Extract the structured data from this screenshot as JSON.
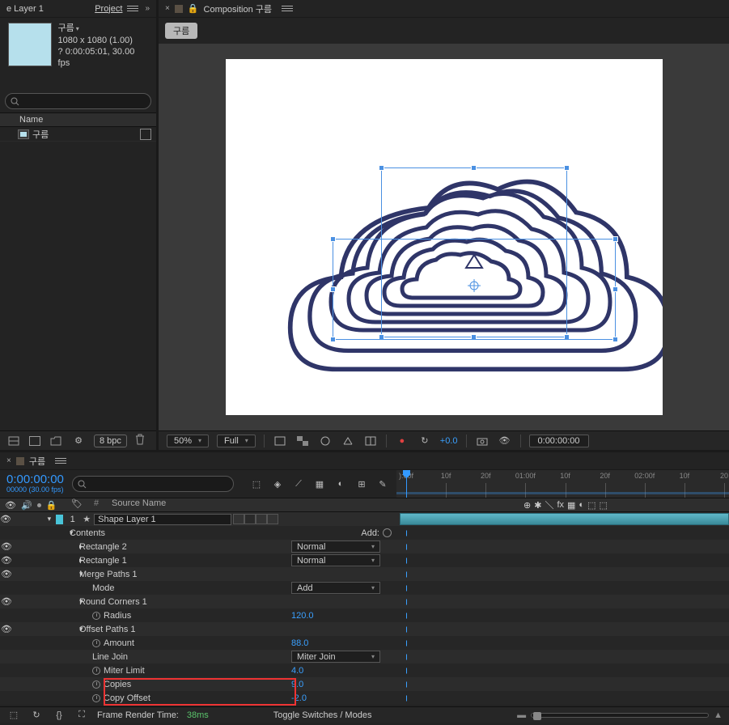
{
  "project": {
    "tab_partial": "e Layer 1",
    "panel_label": "Project",
    "comp_name": "구름",
    "dims": "1080 x 1080 (1.00)",
    "duration": "? 0:00:05:01, 30.00 fps",
    "bpc": "8 bpc",
    "col_name": "Name",
    "row_name": "구름"
  },
  "viewer": {
    "tab_prefix": "Composition",
    "tab_name": "구름",
    "crumb": "구름",
    "zoom": "50%",
    "res": "Full",
    "exposure": "+0.0",
    "timecode": "0:00:00:00"
  },
  "timeline": {
    "tab_name": "구름",
    "current_time": "0:00:00:00",
    "frame_fps": "00000 (30.00 fps)",
    "ruler": [
      "):00f",
      "10f",
      "20f",
      "01:00f",
      "10f",
      "20f",
      "02:00f",
      "10f",
      "20"
    ],
    "col_num": "#",
    "col_source": "Source Name",
    "layer_num": "1",
    "layer_name": "Shape Layer 1",
    "contents": "Contents",
    "add": "Add:",
    "rect2": "Rectangle 2",
    "rect1": "Rectangle 1",
    "normal": "Normal",
    "merge": "Merge Paths 1",
    "mode": "Mode",
    "mode_val": "Add",
    "round": "Round Corners 1",
    "radius": "Radius",
    "radius_val": "120.0",
    "offset": "Offset Paths 1",
    "amount": "Amount",
    "amount_val": "88.0",
    "linejoin": "Line Join",
    "linejoin_val": "Miter Join",
    "miter": "Miter Limit",
    "miter_val": "4.0",
    "copies": "Copies",
    "copies_val": "9.0",
    "copyoff": "Copy Offset",
    "copyoff_val": "-2.0",
    "frt_label": "Frame Render Time:",
    "frt_val": "38ms",
    "toggle": "Toggle Switches / Modes"
  },
  "chart_data": {
    "type": "table",
    "note": "After Effects shape layer property values (highlighted Copies/Copy Offset)",
    "properties": [
      {
        "name": "Radius",
        "value": 120.0
      },
      {
        "name": "Amount",
        "value": 88.0
      },
      {
        "name": "Line Join",
        "value": "Miter Join"
      },
      {
        "name": "Miter Limit",
        "value": 4.0
      },
      {
        "name": "Copies",
        "value": 9.0
      },
      {
        "name": "Copy Offset",
        "value": -2.0
      }
    ]
  }
}
